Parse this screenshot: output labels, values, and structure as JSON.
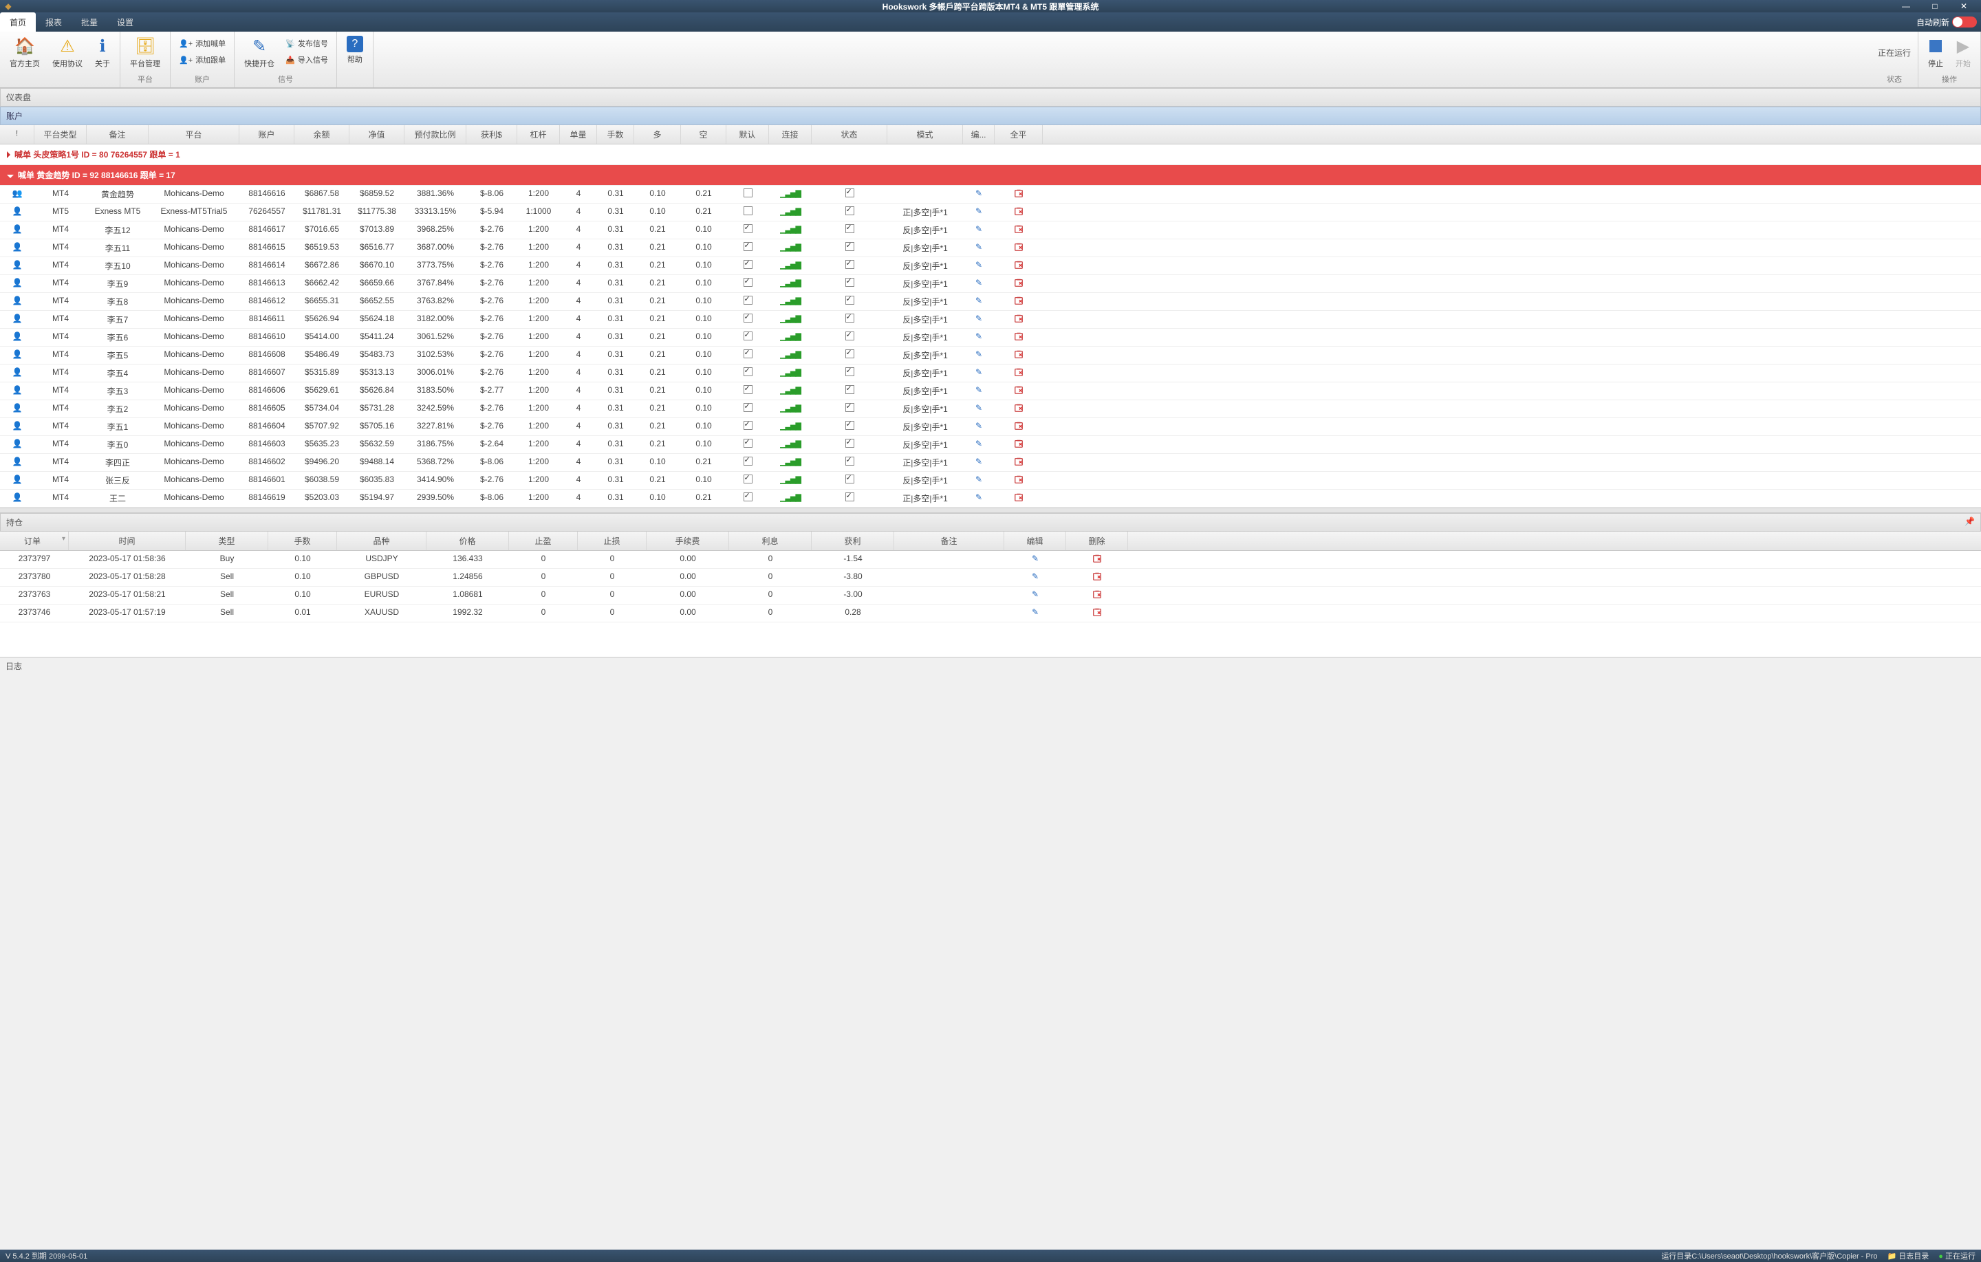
{
  "title": "Hookswork 多帳戶跨平台跨版本MT4 & MT5 跟單管理系统",
  "menu": {
    "tabs": [
      "首页",
      "报表",
      "批量",
      "设置"
    ],
    "auto_refresh": "自动刷新"
  },
  "ribbon": {
    "official": "官方主页",
    "agreement": "使用协议",
    "about": "关于",
    "platform_mgmt": "平台管理",
    "platform_group": "平台",
    "add_shout": "添加喊单",
    "add_follow": "添加跟单",
    "account_group": "账户",
    "quick_open": "快捷开仓",
    "publish_signal": "发布信号",
    "import_signal": "导入信号",
    "signal_group": "信号",
    "help": "帮助",
    "running": "正在运行",
    "stop": "停止",
    "start": "开始",
    "status_group": "状态",
    "operation_group": "操作"
  },
  "dashboard_label": "仪表盘",
  "accounts": {
    "panel_title": "账户",
    "cols": [
      "!",
      "平台类型",
      "备注",
      "平台",
      "账户",
      "余额",
      "净值",
      "预付款比例",
      "获利$",
      "杠杆",
      "单量",
      "手数",
      "多",
      "空",
      "默认",
      "连接",
      "状态",
      "模式",
      "编...",
      "全平"
    ],
    "group1": "喊单  头皮策略1号 ID = 80 76264557  跟单 = 1",
    "group2": "喊单  黄金趋势 ID = 92 88146616  跟单 = 17",
    "rows": [
      {
        "ico": "lead",
        "pt": "MT4",
        "note": "黄金趋势",
        "plat": "Mohicans-Demo",
        "acc": "88146616",
        "bal": "$6867.58",
        "eq": "$6859.52",
        "mar": "3881.36%",
        "pl": "$-8.06",
        "lev": "1:200",
        "qty": "4",
        "lot": "0.31",
        "buy": "0.10",
        "sell": "0.21",
        "def": false,
        "mode": ""
      },
      {
        "ico": "p",
        "pt": "MT5",
        "note": "Exness MT5",
        "plat": "Exness-MT5Trial5",
        "acc": "76264557",
        "bal": "$11781.31",
        "eq": "$11775.38",
        "mar": "33313.15%",
        "pl": "$-5.94",
        "lev": "1:1000",
        "qty": "4",
        "lot": "0.31",
        "buy": "0.10",
        "sell": "0.21",
        "def": false,
        "mode": "正|多空|手*1"
      },
      {
        "ico": "p",
        "pt": "MT4",
        "note": "李五12",
        "plat": "Mohicans-Demo",
        "acc": "88146617",
        "bal": "$7016.65",
        "eq": "$7013.89",
        "mar": "3968.25%",
        "pl": "$-2.76",
        "lev": "1:200",
        "qty": "4",
        "lot": "0.31",
        "buy": "0.21",
        "sell": "0.10",
        "def": true,
        "mode": "反|多空|手*1"
      },
      {
        "ico": "p",
        "pt": "MT4",
        "note": "李五11",
        "plat": "Mohicans-Demo",
        "acc": "88146615",
        "bal": "$6519.53",
        "eq": "$6516.77",
        "mar": "3687.00%",
        "pl": "$-2.76",
        "lev": "1:200",
        "qty": "4",
        "lot": "0.31",
        "buy": "0.21",
        "sell": "0.10",
        "def": true,
        "mode": "反|多空|手*1"
      },
      {
        "ico": "p",
        "pt": "MT4",
        "note": "李五10",
        "plat": "Mohicans-Demo",
        "acc": "88146614",
        "bal": "$6672.86",
        "eq": "$6670.10",
        "mar": "3773.75%",
        "pl": "$-2.76",
        "lev": "1:200",
        "qty": "4",
        "lot": "0.31",
        "buy": "0.21",
        "sell": "0.10",
        "def": true,
        "mode": "反|多空|手*1"
      },
      {
        "ico": "p",
        "pt": "MT4",
        "note": "李五9",
        "plat": "Mohicans-Demo",
        "acc": "88146613",
        "bal": "$6662.42",
        "eq": "$6659.66",
        "mar": "3767.84%",
        "pl": "$-2.76",
        "lev": "1:200",
        "qty": "4",
        "lot": "0.31",
        "buy": "0.21",
        "sell": "0.10",
        "def": true,
        "mode": "反|多空|手*1"
      },
      {
        "ico": "p",
        "pt": "MT4",
        "note": "李五8",
        "plat": "Mohicans-Demo",
        "acc": "88146612",
        "bal": "$6655.31",
        "eq": "$6652.55",
        "mar": "3763.82%",
        "pl": "$-2.76",
        "lev": "1:200",
        "qty": "4",
        "lot": "0.31",
        "buy": "0.21",
        "sell": "0.10",
        "def": true,
        "mode": "反|多空|手*1"
      },
      {
        "ico": "p",
        "pt": "MT4",
        "note": "李五7",
        "plat": "Mohicans-Demo",
        "acc": "88146611",
        "bal": "$5626.94",
        "eq": "$5624.18",
        "mar": "3182.00%",
        "pl": "$-2.76",
        "lev": "1:200",
        "qty": "4",
        "lot": "0.31",
        "buy": "0.21",
        "sell": "0.10",
        "def": true,
        "mode": "反|多空|手*1"
      },
      {
        "ico": "p",
        "pt": "MT4",
        "note": "李五6",
        "plat": "Mohicans-Demo",
        "acc": "88146610",
        "bal": "$5414.00",
        "eq": "$5411.24",
        "mar": "3061.52%",
        "pl": "$-2.76",
        "lev": "1:200",
        "qty": "4",
        "lot": "0.31",
        "buy": "0.21",
        "sell": "0.10",
        "def": true,
        "mode": "反|多空|手*1"
      },
      {
        "ico": "p",
        "pt": "MT4",
        "note": "李五5",
        "plat": "Mohicans-Demo",
        "acc": "88146608",
        "bal": "$5486.49",
        "eq": "$5483.73",
        "mar": "3102.53%",
        "pl": "$-2.76",
        "lev": "1:200",
        "qty": "4",
        "lot": "0.31",
        "buy": "0.21",
        "sell": "0.10",
        "def": true,
        "mode": "反|多空|手*1"
      },
      {
        "ico": "p",
        "pt": "MT4",
        "note": "李五4",
        "plat": "Mohicans-Demo",
        "acc": "88146607",
        "bal": "$5315.89",
        "eq": "$5313.13",
        "mar": "3006.01%",
        "pl": "$-2.76",
        "lev": "1:200",
        "qty": "4",
        "lot": "0.31",
        "buy": "0.21",
        "sell": "0.10",
        "def": true,
        "mode": "反|多空|手*1"
      },
      {
        "ico": "p",
        "pt": "MT4",
        "note": "李五3",
        "plat": "Mohicans-Demo",
        "acc": "88146606",
        "bal": "$5629.61",
        "eq": "$5626.84",
        "mar": "3183.50%",
        "pl": "$-2.77",
        "lev": "1:200",
        "qty": "4",
        "lot": "0.31",
        "buy": "0.21",
        "sell": "0.10",
        "def": true,
        "mode": "反|多空|手*1"
      },
      {
        "ico": "p",
        "pt": "MT4",
        "note": "李五2",
        "plat": "Mohicans-Demo",
        "acc": "88146605",
        "bal": "$5734.04",
        "eq": "$5731.28",
        "mar": "3242.59%",
        "pl": "$-2.76",
        "lev": "1:200",
        "qty": "4",
        "lot": "0.31",
        "buy": "0.21",
        "sell": "0.10",
        "def": true,
        "mode": "反|多空|手*1"
      },
      {
        "ico": "p",
        "pt": "MT4",
        "note": "李五1",
        "plat": "Mohicans-Demo",
        "acc": "88146604",
        "bal": "$5707.92",
        "eq": "$5705.16",
        "mar": "3227.81%",
        "pl": "$-2.76",
        "lev": "1:200",
        "qty": "4",
        "lot": "0.31",
        "buy": "0.21",
        "sell": "0.10",
        "def": true,
        "mode": "反|多空|手*1"
      },
      {
        "ico": "p",
        "pt": "MT4",
        "note": "李五0",
        "plat": "Mohicans-Demo",
        "acc": "88146603",
        "bal": "$5635.23",
        "eq": "$5632.59",
        "mar": "3186.75%",
        "pl": "$-2.64",
        "lev": "1:200",
        "qty": "4",
        "lot": "0.31",
        "buy": "0.21",
        "sell": "0.10",
        "def": true,
        "mode": "反|多空|手*1"
      },
      {
        "ico": "p",
        "pt": "MT4",
        "note": "李四正",
        "plat": "Mohicans-Demo",
        "acc": "88146602",
        "bal": "$9496.20",
        "eq": "$9488.14",
        "mar": "5368.72%",
        "pl": "$-8.06",
        "lev": "1:200",
        "qty": "4",
        "lot": "0.31",
        "buy": "0.10",
        "sell": "0.21",
        "def": true,
        "mode": "正|多空|手*1"
      },
      {
        "ico": "p",
        "pt": "MT4",
        "note": "张三反",
        "plat": "Mohicans-Demo",
        "acc": "88146601",
        "bal": "$6038.59",
        "eq": "$6035.83",
        "mar": "3414.90%",
        "pl": "$-2.76",
        "lev": "1:200",
        "qty": "4",
        "lot": "0.31",
        "buy": "0.21",
        "sell": "0.10",
        "def": true,
        "mode": "反|多空|手*1"
      },
      {
        "ico": "p",
        "pt": "MT4",
        "note": "王二",
        "plat": "Mohicans-Demo",
        "acc": "88146619",
        "bal": "$5203.03",
        "eq": "$5194.97",
        "mar": "2939.50%",
        "pl": "$-8.06",
        "lev": "1:200",
        "qty": "4",
        "lot": "0.31",
        "buy": "0.10",
        "sell": "0.21",
        "def": true,
        "mode": "正|多空|手*1"
      }
    ]
  },
  "positions": {
    "panel_title": "持仓",
    "cols": [
      "订单",
      "时间",
      "类型",
      "手数",
      "品种",
      "价格",
      "止盈",
      "止损",
      "手续费",
      "利息",
      "获利",
      "备注",
      "编辑",
      "删除"
    ],
    "rows": [
      {
        "id": "2373797",
        "time": "2023-05-17 01:58:36",
        "type": "Buy",
        "lot": "0.10",
        "sym": "USDJPY",
        "price": "136.433",
        "tp": "0",
        "sl": "0",
        "fee": "0.00",
        "swap": "0",
        "pl": "-1.54",
        "note": ""
      },
      {
        "id": "2373780",
        "time": "2023-05-17 01:58:28",
        "type": "Sell",
        "lot": "0.10",
        "sym": "GBPUSD",
        "price": "1.24856",
        "tp": "0",
        "sl": "0",
        "fee": "0.00",
        "swap": "0",
        "pl": "-3.80",
        "note": ""
      },
      {
        "id": "2373763",
        "time": "2023-05-17 01:58:21",
        "type": "Sell",
        "lot": "0.10",
        "sym": "EURUSD",
        "price": "1.08681",
        "tp": "0",
        "sl": "0",
        "fee": "0.00",
        "swap": "0",
        "pl": "-3.00",
        "note": ""
      },
      {
        "id": "2373746",
        "time": "2023-05-17 01:57:19",
        "type": "Sell",
        "lot": "0.01",
        "sym": "XAUUSD",
        "price": "1992.32",
        "tp": "0",
        "sl": "0",
        "fee": "0.00",
        "swap": "0",
        "pl": "0.28",
        "note": ""
      }
    ]
  },
  "log_label": "日志",
  "status": {
    "version": "V 5.4.2    到期 2099-05-01",
    "rundir": "运行目录C:\\Users\\seaot\\Desktop\\hookswork\\客户版\\Copier - Pro",
    "logdir": "日志目录",
    "running": "正在运行"
  }
}
